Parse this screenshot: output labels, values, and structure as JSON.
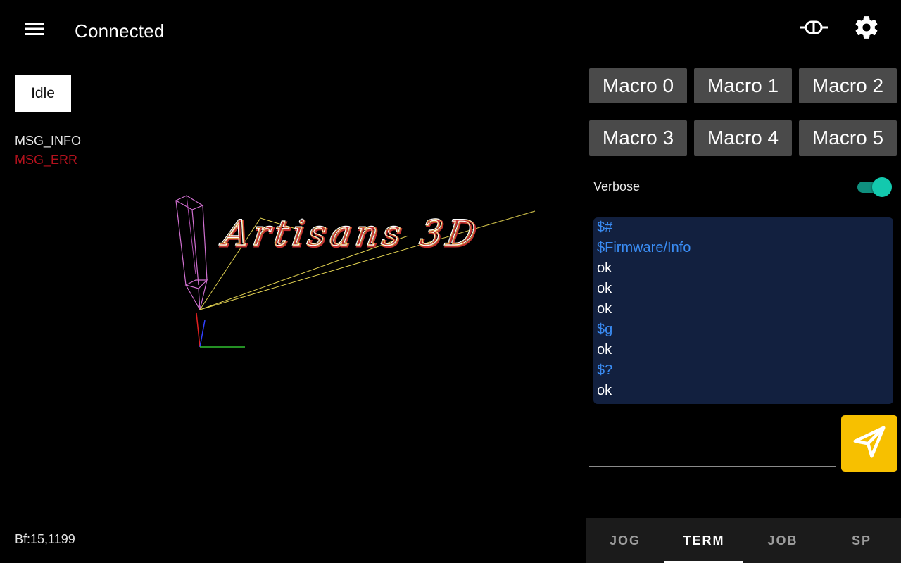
{
  "header": {
    "title": "Connected",
    "menu_icon": "hamburger-menu-icon",
    "connection_icon": "plug-disconnect-icon",
    "settings_icon": "gear-icon"
  },
  "status": {
    "state": "Idle",
    "msg_info": "MSG_INFO",
    "msg_err": "MSG_ERR",
    "buffer": "Bf:15,1199"
  },
  "visualizer": {
    "text": "Artisans 3D"
  },
  "macros": [
    "Macro 0",
    "Macro 1",
    "Macro 2",
    "Macro 3",
    "Macro 4",
    "Macro 5"
  ],
  "verbose": {
    "label": "Verbose",
    "enabled": true
  },
  "terminal": {
    "lines": [
      {
        "text": "$#",
        "kind": "cmd"
      },
      {
        "text": "$Firmware/Info",
        "kind": "cmd"
      },
      {
        "text": "ok",
        "kind": "resp"
      },
      {
        "text": "ok",
        "kind": "resp"
      },
      {
        "text": "ok",
        "kind": "resp"
      },
      {
        "text": "$g",
        "kind": "cmd"
      },
      {
        "text": "ok",
        "kind": "resp"
      },
      {
        "text": "$?",
        "kind": "cmd"
      },
      {
        "text": "ok",
        "kind": "resp"
      }
    ]
  },
  "input": {
    "value": "",
    "placeholder": ""
  },
  "send_icon": "send-icon",
  "tabs": [
    {
      "label": "JOG",
      "active": false
    },
    {
      "label": "TERM",
      "active": true
    },
    {
      "label": "JOB",
      "active": false
    },
    {
      "label": "SP",
      "active": false
    }
  ],
  "colors": {
    "accent_send": "#f7c000",
    "toggle_on": "#13c9ae",
    "terminal_bg": "#12203f",
    "command_text": "#3a8df5",
    "error_text": "#b3121d"
  }
}
